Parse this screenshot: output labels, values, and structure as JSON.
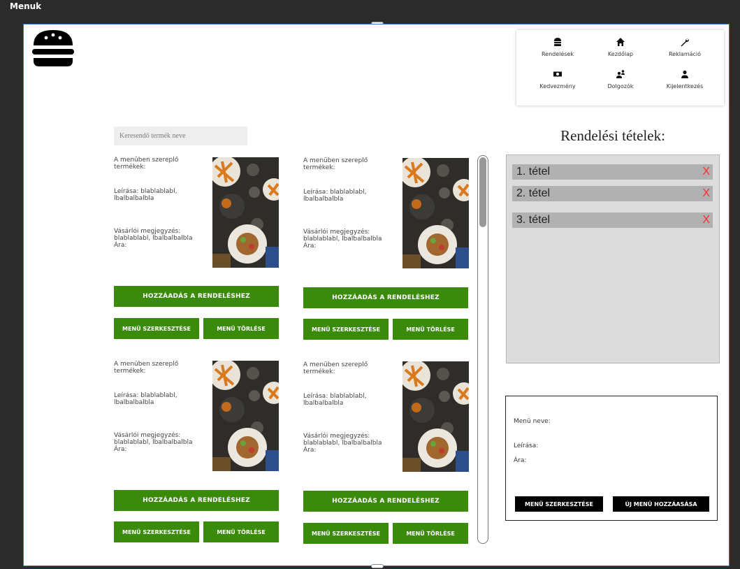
{
  "window": {
    "title": "Menuk"
  },
  "nav": {
    "items": [
      {
        "label": "Rendelések",
        "icon": "burger-icon"
      },
      {
        "label": "Kezdőlap",
        "icon": "home-icon"
      },
      {
        "label": "Reklamáció",
        "icon": "wrench-icon"
      },
      {
        "label": "Kedvezmény",
        "icon": "money-icon"
      },
      {
        "label": "Dolgozók",
        "icon": "users-icon"
      },
      {
        "label": "Kijelentkezés",
        "icon": "user-icon"
      }
    ]
  },
  "search": {
    "placeholder": "Keresendő termék neve"
  },
  "cards": [
    {
      "items_label": "A menüben szereplő termékek:",
      "desc": "Leírása: blablablabl, lbalbalbalbla",
      "note": "Vásárlói megjegyzés: blablablabl, lbalbalbalbla",
      "price": "Ára:",
      "add": "HOZZÁADÁS A RENDELÉSHEZ",
      "edit": "MENÜ SZERKESZTÉSE",
      "delete": "MENÜ TÖRLÉSE"
    },
    {
      "items_label": "A menüben szereplő termékek:",
      "desc": "Leírása: blablablabl, lbalbalbalbla",
      "note": "Vásárlói megjegyzés: blablablabl, lbalbalbalbla",
      "price": "Ára:",
      "add": "HOZZÁADÁS A RENDELÉSHEZ",
      "edit": "MENÜ SZERKESZTÉSE",
      "delete": "MENÜ TÖRLÉSE"
    },
    {
      "items_label": "A menüben szereplő termékek:",
      "desc": "Leírása: blablablabl, lbalbalbalbla",
      "note": "Vásárlói megjegyzés: blablablabl, lbalbalbalbla",
      "price": "Ára:",
      "add": "HOZZÁADÁS A RENDELÉSHEZ",
      "edit": "MENÜ SZERKESZTÉSE",
      "delete": "MENÜ TÖRLÉSE"
    },
    {
      "items_label": "A menüben szereplő termékek:",
      "desc": "Leírása: blablablabl, lbalbalbalbla",
      "note": "Vásárlói megjegyzés: blablablabl, lbalbalbalbla",
      "price": "Ára:",
      "add": "HOZZÁADÁS A RENDELÉSHEZ",
      "edit": "MENÜ SZERKESZTÉSE",
      "delete": "MENÜ TÖRLÉSE"
    }
  ],
  "order": {
    "title": "Rendelési tételek:",
    "items": [
      {
        "label": "1. tétel",
        "remove": "X"
      },
      {
        "label": "2. tétel",
        "remove": "X"
      },
      {
        "label": "3. tétel",
        "remove": "X"
      }
    ]
  },
  "menu_form": {
    "name_label": "Menü neve:",
    "desc_label": "Leírása:",
    "price_label": "Ára:",
    "edit_button": "MENÜ SZERKESZTÉSE",
    "new_button": "ÚJ MENÜ HOZZÁASÁSA"
  },
  "colors": {
    "accent_green": "#3a8a0c",
    "remove_red": "#ff2b2b",
    "frame_border": "#3b78c4"
  }
}
